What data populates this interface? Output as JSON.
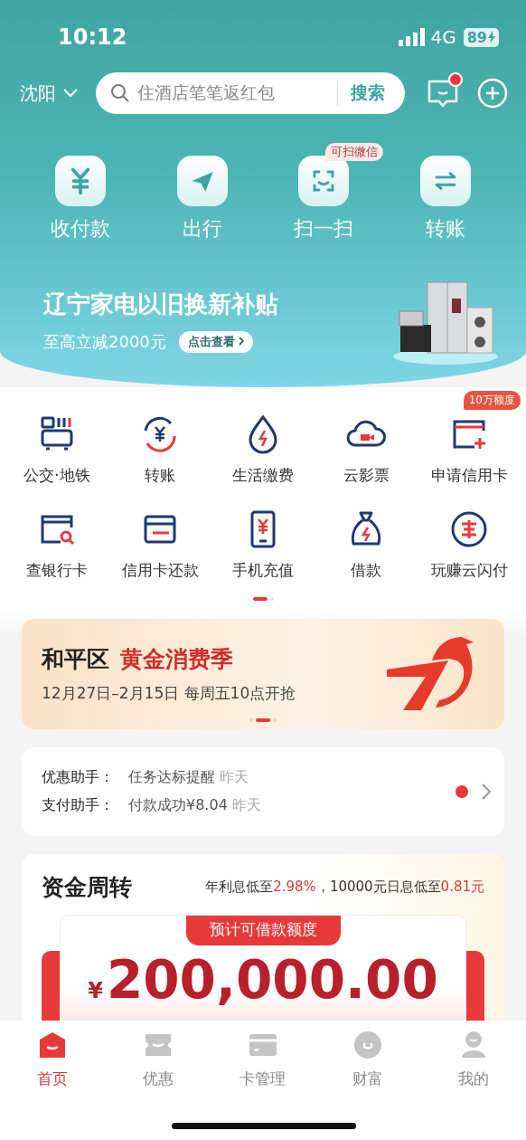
{
  "status_bar": {
    "time": "10:12",
    "network": "4G",
    "battery": "89"
  },
  "header": {
    "city": "沈阳",
    "search": {
      "placeholder": "住酒店笔笔返红包",
      "button": "搜索"
    },
    "message_unread": true
  },
  "quick_actions": [
    {
      "label": "收付款"
    },
    {
      "label": "出行"
    },
    {
      "label": "扫一扫",
      "badge": "可扫微信"
    },
    {
      "label": "转账"
    }
  ],
  "hero_banner": {
    "title": "辽宁家电以旧换新补贴",
    "subtitle": "至高立减2000元",
    "button": "点击查看"
  },
  "services": [
    {
      "label": "公交·地铁"
    },
    {
      "label": "转账"
    },
    {
      "label": "生活缴费"
    },
    {
      "label": "云影票"
    },
    {
      "label": "申请信用卡",
      "badge": "10万额度"
    },
    {
      "label": "查银行卡"
    },
    {
      "label": "信用卡还款"
    },
    {
      "label": "手机充值"
    },
    {
      "label": "借款"
    },
    {
      "label": "玩赚云闪付"
    }
  ],
  "services_pager": [
    {
      "selected": true
    },
    {
      "selected": false
    }
  ],
  "promo": {
    "district": "和平区",
    "title": "黄金消费季",
    "dates": "12月27日–2月15日 每周五10点开抢",
    "pager": [
      {
        "selected": false
      },
      {
        "selected": true
      },
      {
        "selected": false
      }
    ]
  },
  "assistants": {
    "rows": [
      {
        "label": "优惠助手：",
        "message": "任务达标提醒",
        "time": "昨天"
      },
      {
        "label": "支付助手：",
        "message": "付款成功¥8.04",
        "time": "昨天"
      }
    ],
    "unread": true
  },
  "loan": {
    "title": "资金周转",
    "rate_parts": [
      {
        "kind": "plain",
        "text": "年利息低至"
      },
      {
        "kind": "highlight",
        "text": "2.98%"
      },
      {
        "kind": "plain",
        "text": "，10000元日息低至"
      },
      {
        "kind": "highlight",
        "text": "0.81元"
      }
    ],
    "tag": "预计可借款额度",
    "currency": "¥",
    "amount": "200,000.00"
  },
  "tab_bar": [
    {
      "label": "首页",
      "selected": true
    },
    {
      "label": "优惠",
      "selected": false
    },
    {
      "label": "卡管理",
      "selected": false
    },
    {
      "label": "财富",
      "selected": false
    },
    {
      "label": "我的",
      "selected": false
    }
  ]
}
